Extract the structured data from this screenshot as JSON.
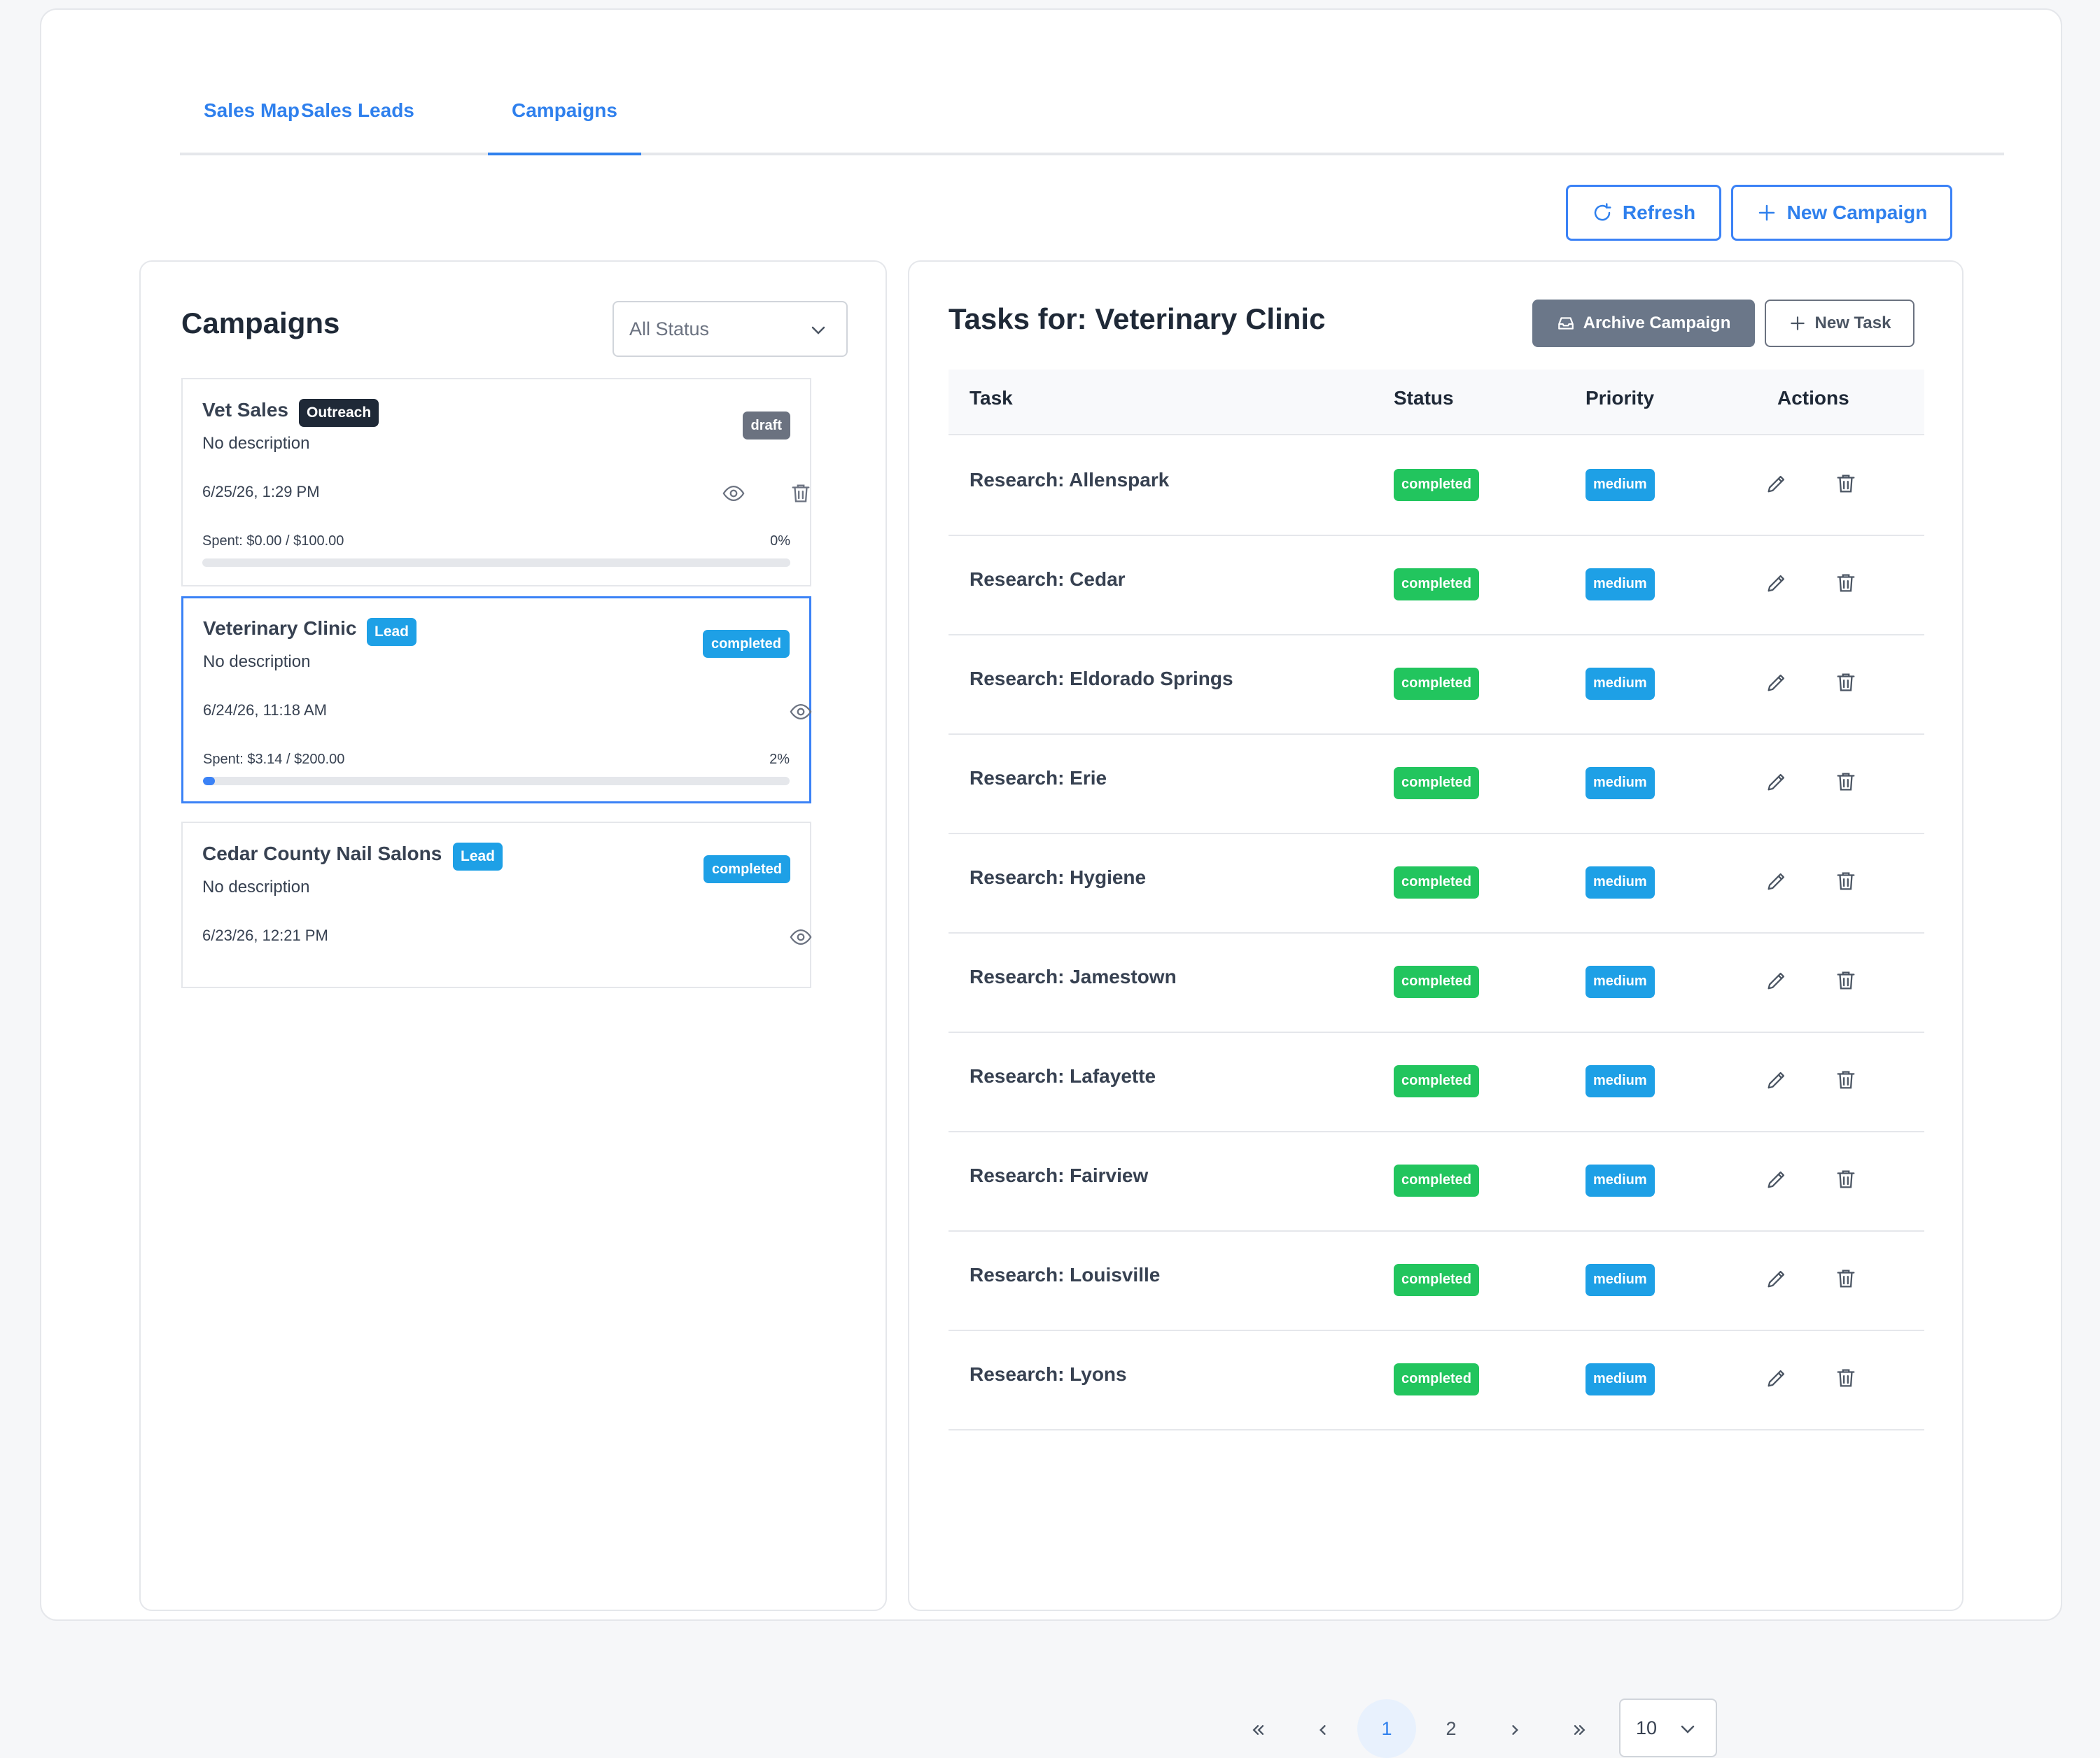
{
  "tabs": [
    {
      "label": "Sales Map"
    },
    {
      "label": "Sales Leads"
    },
    {
      "label": "Campaigns"
    }
  ],
  "toolbar": {
    "refresh_label": "Refresh",
    "new_campaign_label": "New Campaign"
  },
  "campaigns_panel": {
    "title": "Campaigns",
    "status_filter": "All Status",
    "campaigns": [
      {
        "name": "Vet Sales",
        "tag": "Outreach",
        "status": "draft",
        "description": "No description",
        "date": "6/25/26, 1:29 PM",
        "spent": "Spent: $0.00 / $100.00",
        "percent_label": "0%",
        "progress": 0
      },
      {
        "name": "Veterinary Clinic",
        "tag": "Lead",
        "status": "completed",
        "description": "No description",
        "date": "6/24/26, 11:18 AM",
        "spent": "Spent: $3.14 / $200.00",
        "percent_label": "2%",
        "progress": 0.02
      },
      {
        "name": "Cedar County Nail Salons",
        "tag": "Lead",
        "status": "completed",
        "description": "No description",
        "date": "6/23/26, 12:21 PM"
      }
    ]
  },
  "tasks_panel": {
    "title": "Tasks for: Veterinary Clinic",
    "archive_label": "Archive Campaign",
    "new_task_label": "New Task",
    "columns": [
      "Task",
      "Status",
      "Priority",
      "Actions"
    ],
    "rows": [
      {
        "task": "Research: Allenspark",
        "status": "completed",
        "priority": "medium"
      },
      {
        "task": "Research: Cedar",
        "status": "completed",
        "priority": "medium"
      },
      {
        "task": "Research: Eldorado Springs",
        "status": "completed",
        "priority": "medium"
      },
      {
        "task": "Research: Erie",
        "status": "completed",
        "priority": "medium"
      },
      {
        "task": "Research: Hygiene",
        "status": "completed",
        "priority": "medium"
      },
      {
        "task": "Research: Jamestown",
        "status": "completed",
        "priority": "medium"
      },
      {
        "task": "Research: Lafayette",
        "status": "completed",
        "priority": "medium"
      },
      {
        "task": "Research: Fairview",
        "status": "completed",
        "priority": "medium"
      },
      {
        "task": "Research: Louisville",
        "status": "completed",
        "priority": "medium"
      },
      {
        "task": "Research: Lyons",
        "status": "completed",
        "priority": "medium"
      }
    ],
    "pagination": {
      "pages": [
        "1",
        "2"
      ],
      "current": "1",
      "page_size": "10"
    }
  },
  "icons": {
    "refresh": "refresh-icon",
    "plus": "plus-icon",
    "chevron": "chevron-down-icon",
    "eye": "eye-icon",
    "trash": "trash-icon",
    "pencil": "pencil-icon",
    "archive": "archive-icon"
  },
  "colors": {
    "accent": "#2f80ed",
    "completed_green": "#22c55e",
    "info_blue": "#1ea0e6",
    "draft_gray": "#6b7280",
    "dark_tag": "#1f2937"
  }
}
